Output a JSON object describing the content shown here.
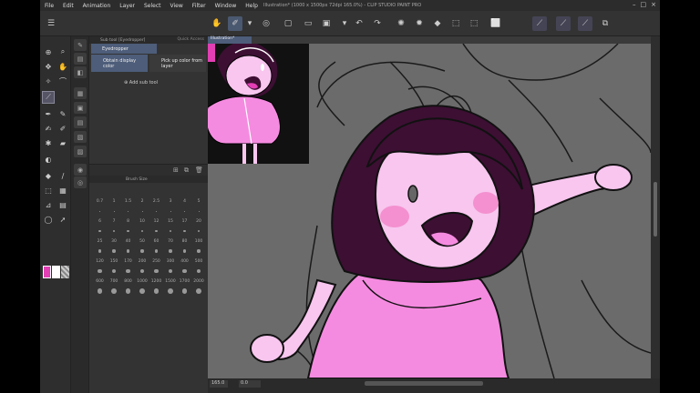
{
  "app": {
    "title": "Illustration* (1000 x 1500px 72dpi 165.0%)  - CLIP STUDIO PAINT PRO",
    "menu": [
      "File",
      "Edit",
      "Animation",
      "Layer",
      "Select",
      "View",
      "Filter",
      "Window",
      "Help"
    ]
  },
  "subtool": {
    "header": "Sub tool [Eyedropper]",
    "quick_access": "Quick Access",
    "tab": "Eyedropper",
    "option_a": "Obtain display color",
    "option_b": "Pick up color from layer",
    "add_label": "Add sub tool"
  },
  "brush": {
    "header": "Brush Size",
    "sizes": [
      "0.7",
      "1",
      "1.5",
      "2",
      "2.5",
      "3",
      "4",
      "5",
      "6",
      "7",
      "8",
      "10",
      "12",
      "15",
      "17",
      "20",
      "25",
      "30",
      "40",
      "50",
      "60",
      "70",
      "80",
      "100",
      "120",
      "150",
      "170",
      "200",
      "250",
      "300",
      "400",
      "500",
      "600",
      "700",
      "800",
      "1000",
      "1200",
      "1500",
      "1700",
      "2000"
    ]
  },
  "canvas": {
    "tab": "Illustration*",
    "zoom": "165.0",
    "angle": "0.0"
  },
  "colors": {
    "main": "#e23fb4",
    "sub": "#ffffff",
    "skin": "#f8c6ef",
    "dress": "#f58be0",
    "hair": "#3d0f33",
    "blush": "#f490cf"
  }
}
